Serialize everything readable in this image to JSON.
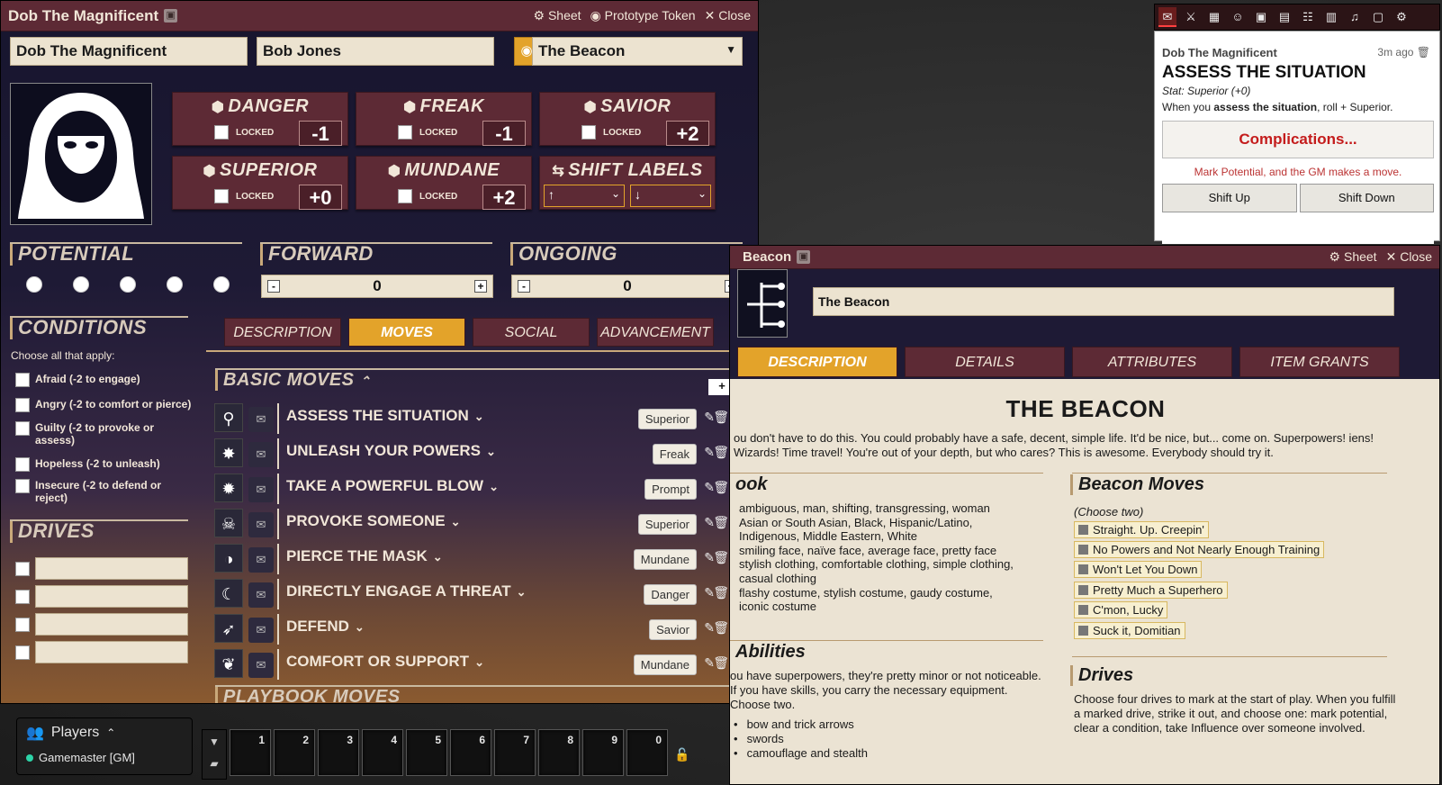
{
  "char_sheet": {
    "title": "Dob The Magnificent",
    "controls": {
      "sheet": "Sheet",
      "prototype": "Prototype Token",
      "close": "Close"
    },
    "name": "Dob The Magnificent",
    "player": "Bob Jones",
    "playbook": "The Beacon",
    "stats": [
      {
        "name": "DANGER",
        "lock": "LOCKED",
        "value": "-1"
      },
      {
        "name": "FREAK",
        "lock": "LOCKED",
        "value": "-1"
      },
      {
        "name": "SAVIOR",
        "lock": "LOCKED",
        "value": "+2"
      },
      {
        "name": "SUPERIOR",
        "lock": "LOCKED",
        "value": "+0"
      },
      {
        "name": "MUNDANE",
        "lock": "LOCKED",
        "value": "+2"
      }
    ],
    "shift_labels": {
      "title": "SHIFT LABELS",
      "up": "↑",
      "down": "↓"
    },
    "potential": {
      "title": "POTENTIAL"
    },
    "forward": {
      "title": "FORWARD",
      "value": "0",
      "minus": "-",
      "plus": "+"
    },
    "ongoing": {
      "title": "ONGOING",
      "value": "0",
      "minus": "-",
      "plus": "+"
    },
    "conditions": {
      "title": "CONDITIONS",
      "help": "Choose all that apply:",
      "items": [
        "Afraid (-2 to engage)",
        "Angry (-2 to comfort or pierce)",
        "Guilty (-2 to provoke or assess)",
        "Hopeless (-2 to unleash)",
        "Insecure (-2 to defend or reject)"
      ]
    },
    "drives": {
      "title": "DRIVES"
    },
    "tabs": [
      "DESCRIPTION",
      "MOVES",
      "SOCIAL",
      "ADVANCEMENT"
    ],
    "basic_moves": {
      "title": "BASIC MOVES",
      "add": "+",
      "moves": [
        {
          "name": "ASSESS THE SITUATION",
          "stat": "Superior",
          "icon": "magnifier-icon"
        },
        {
          "name": "UNLEASH YOUR POWERS",
          "stat": "Freak",
          "icon": "burst-icon"
        },
        {
          "name": "TAKE A POWERFUL BLOW",
          "stat": "Prompt",
          "icon": "explosion-icon"
        },
        {
          "name": "PROVOKE SOMEONE",
          "stat": "Superior",
          "icon": "villain-icon"
        },
        {
          "name": "PIERCE THE MASK",
          "stat": "Mundane",
          "icon": "mask-icon"
        },
        {
          "name": "DIRECTLY ENGAGE A THREAT",
          "stat": "Danger",
          "icon": "claw-icon"
        },
        {
          "name": "DEFEND",
          "stat": "Savior",
          "icon": "shield-arrows-icon"
        },
        {
          "name": "COMFORT OR SUPPORT",
          "stat": "Mundane",
          "icon": "hug-icon"
        }
      ]
    },
    "playbook_moves": {
      "title": "PLAYBOOK MOVES"
    }
  },
  "players": {
    "title": "Players",
    "gm": "Gamemaster [GM]"
  },
  "hotbar": {
    "slots": [
      "1",
      "2",
      "3",
      "4",
      "5",
      "6",
      "7",
      "8",
      "9",
      "0"
    ]
  },
  "sidebar": {
    "tabs": [
      "chat-icon",
      "combat-icon",
      "scenes-icon",
      "actors-icon",
      "items-icon",
      "journal-icon",
      "tables-icon",
      "cards-icon",
      "playlists-icon",
      "compendium-icon",
      "settings-icon"
    ]
  },
  "chat": {
    "speaker": "Dob The Magnificent",
    "time": "3m ago",
    "move": "ASSESS THE SITUATION",
    "stat": "Stat: Superior (+0)",
    "desc_pre": "When you ",
    "desc_bold": "assess the situation",
    "desc_post": ", roll + Superior.",
    "result": "Complications...",
    "result_desc": "Mark Potential, and the GM makes a move.",
    "shift_up": "Shift Up",
    "shift_down": "Shift Down"
  },
  "item_sheet": {
    "title": "Beacon",
    "controls": {
      "sheet": "Sheet",
      "close": "Close"
    },
    "name": "The Beacon",
    "tabs": [
      "DESCRIPTION",
      "DETAILS",
      "ATTRIBUTES",
      "ITEM GRANTS"
    ],
    "heading": "THE BEACON",
    "intro": "ou don't have to do this. You could probably have a safe, decent, simple life. It'd be nice, but... come on. Superpowers! iens! Wizards! Time travel! You're out of your depth, but who cares? This is awesome. Everybody should try it.",
    "look_title": "ook",
    "look": [
      "ambiguous, man, shifting, transgressing, woman",
      "Asian or South Asian, Black, Hispanic/Latino,",
      "Indigenous, Middle Eastern, White",
      "smiling face, naïve face, average face, pretty face",
      "stylish clothing, comfortable clothing, simple clothing,",
      "casual clothing",
      "flashy costume, stylish costume, gaudy costume,",
      "iconic costume"
    ],
    "abilities_title": "Abilities",
    "abilities_text": "ou have superpowers, they're pretty minor or not noticeable. If you have skills, you carry the necessary equipment. Choose two.",
    "abilities": [
      "bow and trick arrows",
      "swords",
      "camouflage and stealth"
    ],
    "beacon_moves_title": "Beacon Moves",
    "beacon_moves_sub": "(Choose two)",
    "beacon_moves": [
      "Straight. Up. Creepin'",
      "No Powers and Not Nearly Enough Training",
      "Won't Let You Down",
      "Pretty Much a Superhero",
      "C'mon, Lucky",
      "Suck it, Domitian"
    ],
    "drives_title": "Drives",
    "drives_text": "Choose four drives to mark at the start of play. When you fulfill a marked drive, strike it out, and choose one: mark potential, clear a condition, take Influence over someone involved."
  }
}
